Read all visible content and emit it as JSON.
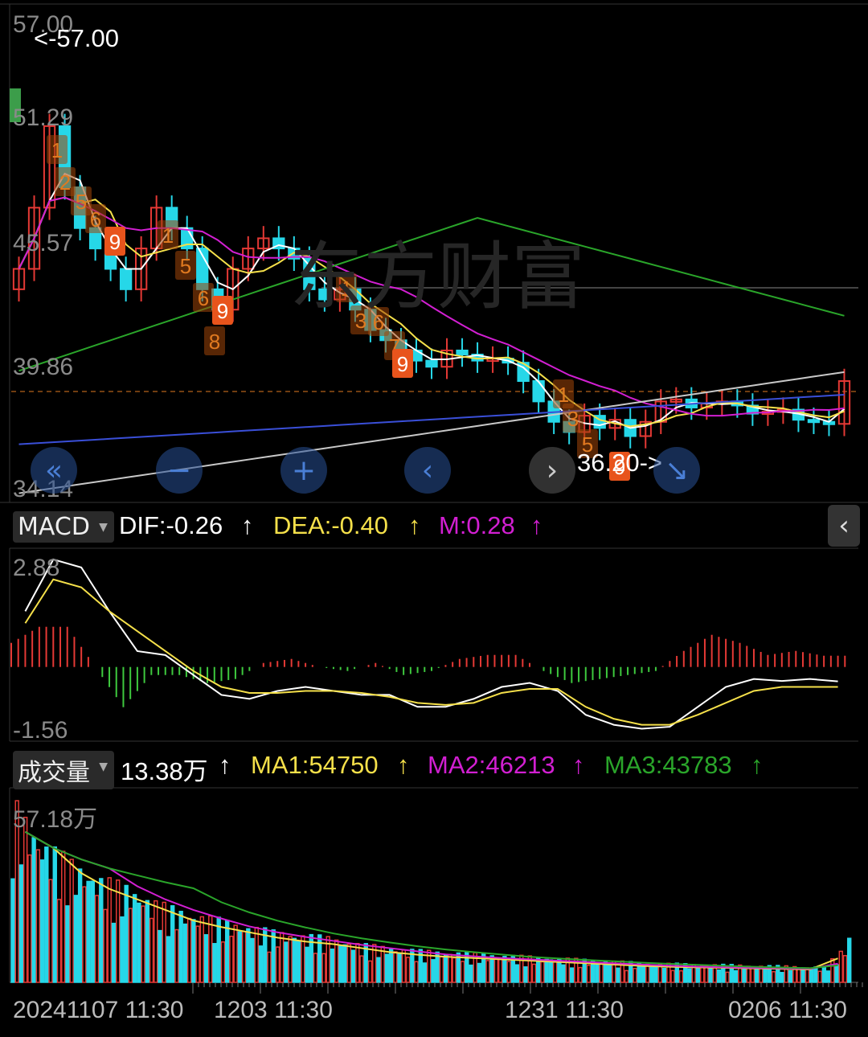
{
  "price_panel": {
    "y_labels": [
      "57.00",
      "51.29",
      "45.57",
      "39.86",
      "34.14"
    ],
    "high_marker": "<-57.00",
    "low_marker": "36.20->",
    "watermark": "东方财富"
  },
  "nav": {
    "first": "«",
    "zoom_out": "−",
    "zoom_in": "+",
    "prev": "‹",
    "next": "›",
    "last": "↘"
  },
  "macd": {
    "selector": "MACD",
    "dif": "DIF:-0.26",
    "dea": "DEA:-0.40",
    "m": "M:0.28",
    "arrow": "↑",
    "y_labels": [
      "2.88",
      "-1.56"
    ],
    "collapse_icon": "‹"
  },
  "volume": {
    "selector": "成交量",
    "value": "13.38万",
    "ma1": "MA1:54750",
    "ma2": "MA2:46213",
    "ma3": "MA3:43783",
    "arrow": "↑",
    "y_label": "57.18万"
  },
  "x_axis": {
    "labels": [
      "20241107 11:30",
      "1203 11:30",
      "1231 11:30",
      "0206 11:30"
    ]
  },
  "colors": {
    "up": "#e53935",
    "down": "#26d7e8",
    "ma_white": "#ffffff",
    "ma_yellow": "#f5e04a",
    "ma_magenta": "#d21fd2",
    "ma_green": "#2aa52a",
    "ma_grey": "#c8c8c8",
    "ma_blue": "#3a4fd8",
    "seq_orange": "#e07a20",
    "seq_red_box": "#e8541c"
  },
  "chart_data": [
    {
      "type": "candlestick",
      "ylim": [
        34.14,
        57.0
      ],
      "close": [
        45,
        48,
        52,
        49,
        47,
        46,
        45,
        44,
        46,
        48,
        47,
        46,
        44,
        43,
        45,
        46,
        46.5,
        46,
        45.5,
        44,
        43.5,
        44,
        43,
        42,
        41.5,
        41,
        40.5,
        40.2,
        41,
        40.8,
        40.5,
        40.6,
        40.4,
        39.5,
        38.5,
        37.5,
        37,
        37.8,
        37.2,
        37.6,
        36.8,
        37.5,
        38.5,
        38.6,
        38.2,
        38.4,
        38.5,
        38.3,
        37.9,
        38,
        38.1,
        37.6,
        37.5,
        37.4,
        39.5
      ],
      "overlays": [
        "MA5 white",
        "MA10 yellow",
        "MA20 magenta",
        "MA60 green",
        "MA120 grey",
        "MA250 blue"
      ]
    },
    {
      "type": "macd",
      "ylim": [
        -1.56,
        2.88
      ],
      "dif": [
        1.5,
        2.8,
        2.6,
        1.5,
        0.5,
        0.4,
        -0.1,
        -0.6,
        -0.7,
        -0.5,
        -0.4,
        -0.5,
        -0.6,
        -0.6,
        -0.9,
        -0.9,
        -0.7,
        -0.4,
        -0.3,
        -0.5,
        -1.1,
        -1.35,
        -1.45,
        -1.4,
        -0.9,
        -0.4,
        -0.2,
        -0.25,
        -0.2,
        -0.26
      ],
      "dea": [
        1.2,
        2.3,
        2.1,
        1.5,
        1.0,
        0.5,
        0.0,
        -0.4,
        -0.55,
        -0.55,
        -0.5,
        -0.5,
        -0.55,
        -0.65,
        -0.8,
        -0.85,
        -0.8,
        -0.55,
        -0.45,
        -0.45,
        -0.9,
        -1.2,
        -1.35,
        -1.35,
        -1.1,
        -0.8,
        -0.5,
        -0.4,
        -0.4,
        -0.4
      ]
    },
    {
      "type": "bar",
      "series_name": "成交量",
      "ylim": [
        0,
        571800
      ],
      "values": [
        571800,
        450000,
        380000,
        330000,
        300000,
        250000,
        220000,
        200000,
        180000,
        160000,
        150000,
        140000,
        120000,
        110000,
        100000,
        95000,
        90000,
        85000,
        80000,
        75000,
        70000,
        65000,
        60000,
        58000,
        56000,
        54000,
        52000,
        50000,
        48000,
        133800
      ]
    }
  ]
}
